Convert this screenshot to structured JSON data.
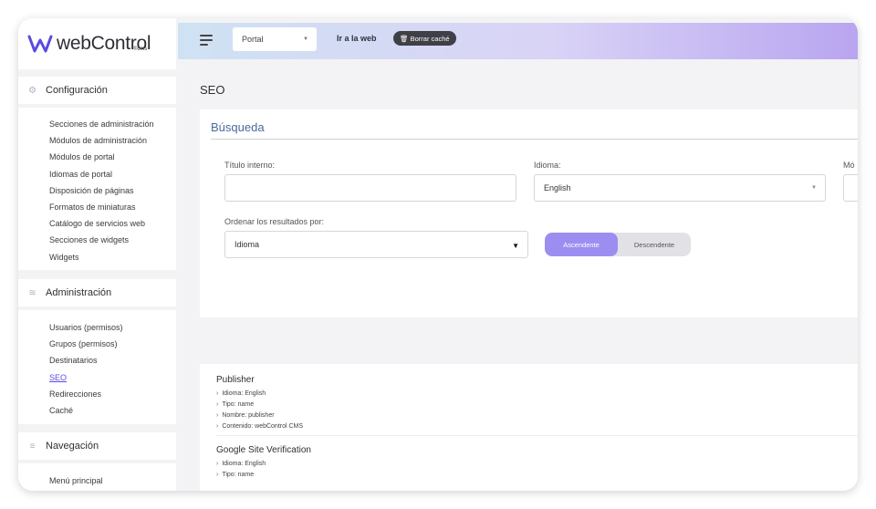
{
  "brand": {
    "name": "webControl",
    "sub": "®cms",
    "color": "#5a4be0"
  },
  "topbar": {
    "portal_value": "Portal",
    "goto_web": "Ir a la web",
    "clear_cache": "🗑 Borrar caché"
  },
  "sidebar": {
    "sections": [
      {
        "label": "Configuración",
        "icon": "gear-icon",
        "items": [
          "Secciones de administración",
          "Módulos de administración",
          "Módulos de portal",
          "Idiomas de portal",
          "Disposición de páginas",
          "Formatos de miniaturas",
          "Catálogo de servicios web",
          "Secciones de widgets",
          "Widgets"
        ]
      },
      {
        "label": "Administración",
        "icon": "sliders-icon",
        "items": [
          "Usuarios (permisos)",
          "Grupos (permisos)",
          "Destinatarios",
          "SEO",
          "Redirecciones",
          "Caché"
        ]
      },
      {
        "label": "Navegación",
        "icon": "menu-icon",
        "items": [
          "Menú principal"
        ]
      }
    ],
    "active_item": "SEO"
  },
  "main": {
    "title": "SEO",
    "search": {
      "title": "Búsqueda",
      "internal_title_label": "Título interno:",
      "internal_title_value": "",
      "language_label": "Idioma:",
      "language_value": "English",
      "third_label": "Mó",
      "order_label": "Ordenar los resultados por:",
      "order_value": "Idioma",
      "ascending": "Ascendente",
      "descending": "Descendente",
      "selected_order": "Ascendente"
    },
    "results": [
      {
        "title": "Publisher",
        "lines": [
          "Idioma: English",
          "Tipo: name",
          "Nombre: publisher",
          "Contenido: webControl CMS"
        ]
      },
      {
        "title": "Google Site Verification",
        "lines": [
          "Idioma: English",
          "Tipo: name"
        ]
      }
    ]
  }
}
